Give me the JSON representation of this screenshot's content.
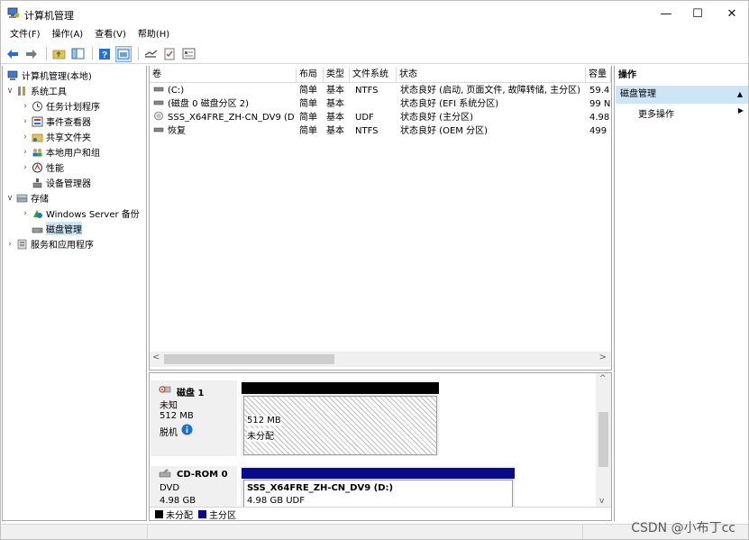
{
  "window": {
    "title": "计算机管理",
    "minimize": "—",
    "maximize": "☐",
    "close": "✕"
  },
  "menu": [
    "文件(F)",
    "操作(A)",
    "查看(V)",
    "帮助(H)"
  ],
  "toolbar_icons": [
    "back-icon",
    "forward-icon",
    "up-folder-icon",
    "show-hide-tree-icon",
    "help-icon",
    "console-icon",
    "connect-icon",
    "checklist-icon",
    "properties-icon"
  ],
  "tree": {
    "root": "计算机管理(本地)",
    "system_tools": "系统工具",
    "task_scheduler": "任务计划程序",
    "event_viewer": "事件查看器",
    "shared_folders": "共享文件夹",
    "local_users": "本地用户和组",
    "performance": "性能",
    "device_manager": "设备管理器",
    "storage": "存储",
    "windows_backup": "Windows Server 备份",
    "disk_management": "磁盘管理",
    "services": "服务和应用程序"
  },
  "volumes": {
    "columns": [
      "卷",
      "布局",
      "类型",
      "文件系统",
      "状态",
      "容量"
    ],
    "rows": [
      {
        "name": "(C:)",
        "layout": "简单",
        "type": "基本",
        "fs": "NTFS",
        "status": "状态良好 (启动, 页面文件, 故障转储, 主分区)",
        "capacity": "59.4"
      },
      {
        "name": "(磁盘 0 磁盘分区 2)",
        "layout": "简单",
        "type": "基本",
        "fs": "",
        "status": "状态良好 (EFI 系统分区)",
        "capacity": "99 N"
      },
      {
        "name": "SSS_X64FRE_ZH-CN_DV9 (D:)",
        "layout": "简单",
        "type": "基本",
        "fs": "UDF",
        "status": "状态良好 (主分区)",
        "capacity": "4.98"
      },
      {
        "name": "恢复",
        "layout": "简单",
        "type": "基本",
        "fs": "NTFS",
        "status": "状态良好 (OEM 分区)",
        "capacity": "499"
      }
    ]
  },
  "disk1": {
    "name": "磁盘 1",
    "kind": "未知",
    "size": "512 MB",
    "state": "脱机",
    "part_size": "512 MB",
    "part_state": "未分配"
  },
  "cdrom0": {
    "name": "CD-ROM 0",
    "kind": "DVD",
    "size": "4.98 GB",
    "part_name": "SSS_X64FRE_ZH-CN_DV9  (D:)",
    "part_size": "4.98 GB UDF"
  },
  "legend": {
    "unallocated": "未分配",
    "primary": "主分区"
  },
  "colors": {
    "unallocated": "#000000",
    "primary": "#0a0a8c",
    "selection": "#cde6f7"
  },
  "actions": {
    "header": "操作",
    "selected": "磁盘管理",
    "more": "更多操作"
  },
  "watermark": "CSDN @小布丁cc"
}
